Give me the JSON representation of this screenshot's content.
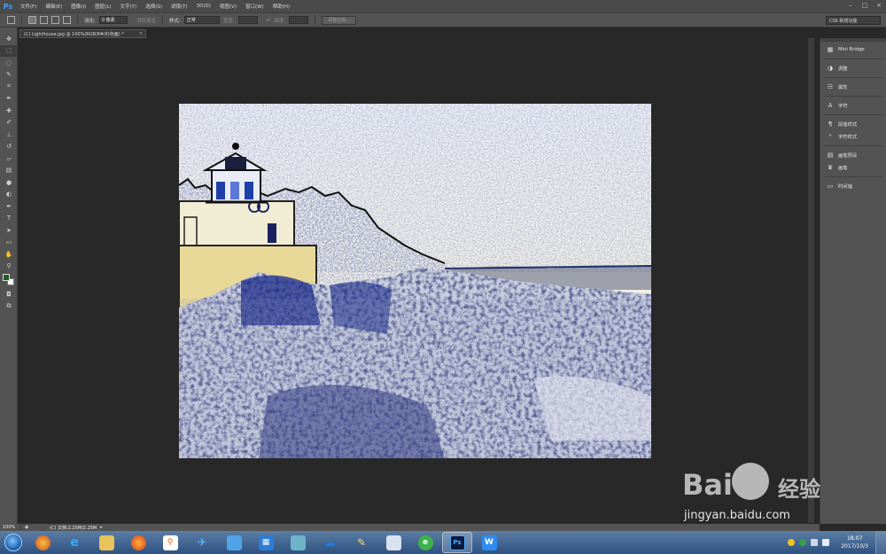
{
  "app": {
    "logo": "Ps"
  },
  "menu": [
    "文件(F)",
    "编辑(E)",
    "图像(I)",
    "图层(L)",
    "文字(Y)",
    "选择(S)",
    "滤镜(T)",
    "3D(D)",
    "视图(V)",
    "窗口(W)",
    "帮助(H)"
  ],
  "options": {
    "feather_label": "羽化:",
    "feather_value": "0 像素",
    "antialias_label": "消除锯齿",
    "style_label": "样式:",
    "style_value": "正常",
    "width_label": "宽度:",
    "height_label": "高度:",
    "refine_button": "调整边缘...",
    "workspace": "CS6 新增功能"
  },
  "document": {
    "tab_title": "(C) Lighthouse.jpg @ 100%(RGB/8#/红色面) *"
  },
  "tools": [
    "move-tool",
    "marquee-tool",
    "lasso-tool",
    "quick-select-tool",
    "crop-tool",
    "eyedropper-tool",
    "spot-healing-tool",
    "brush-tool",
    "clone-stamp-tool",
    "history-brush-tool",
    "eraser-tool",
    "gradient-tool",
    "blur-tool",
    "dodge-tool",
    "pen-tool",
    "type-tool",
    "path-select-tool",
    "rectangle-tool",
    "hand-tool",
    "zoom-tool"
  ],
  "colors": {
    "foreground": "#1f5e1f",
    "background": "#ffffff"
  },
  "right_panel": [
    {
      "label": "Mini Bridge",
      "icon": "mini-bridge-icon"
    },
    {
      "label": "调整",
      "icon": "adjustments-icon"
    },
    {
      "label": "属性",
      "icon": "properties-icon"
    },
    {
      "label": "字符",
      "icon": "character-icon"
    },
    {
      "label": "段落样式",
      "icon": "paragraph-styles-icon"
    },
    {
      "label": "字符样式",
      "icon": "character-styles-icon"
    },
    {
      "label": "画笔预设",
      "icon": "brush-presets-icon"
    },
    {
      "label": "画笔",
      "icon": "brush-icon"
    },
    {
      "label": "时间轴",
      "icon": "timeline-icon"
    }
  ],
  "status": {
    "zoom": "100%",
    "doc_info": "(C) 文档:2.25M/2.25M"
  },
  "taskbar": {
    "time": "18:07",
    "date": "2017/10/3"
  },
  "watermark": {
    "brand": "Bai",
    "cn": "经验",
    "url": "jingyan.baidu.com"
  }
}
